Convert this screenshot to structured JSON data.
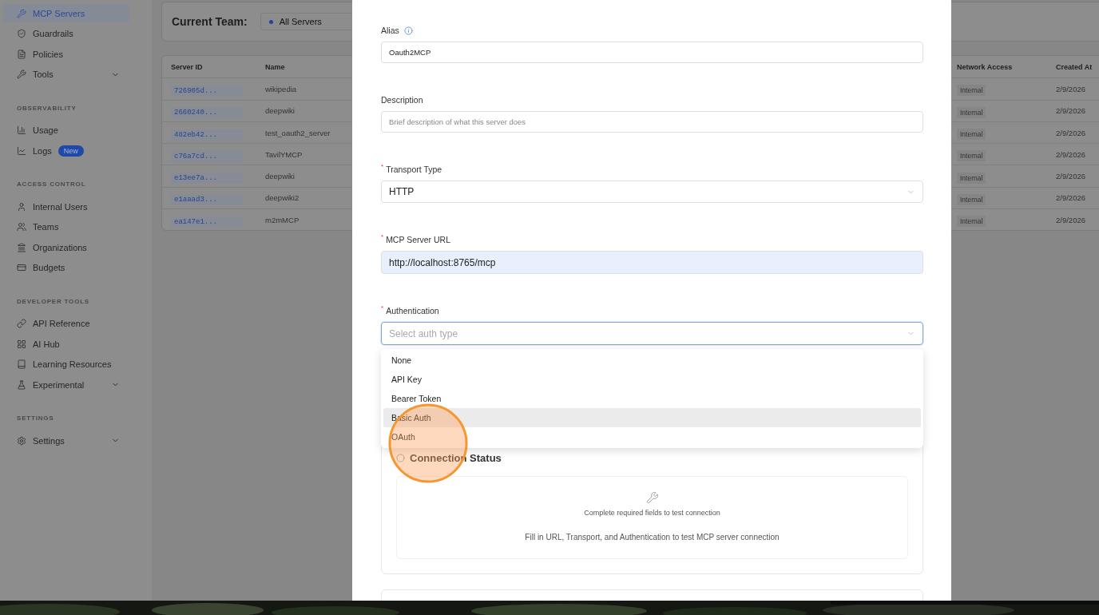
{
  "sidebar": {
    "groups": [
      {
        "items": [
          {
            "label": "MCP Servers",
            "selected": true
          },
          {
            "label": "Guardrails",
            "selected": false
          },
          {
            "label": "Policies",
            "selected": false
          },
          {
            "label": "Tools",
            "selected": false,
            "expanded": false
          }
        ]
      },
      {
        "heading": "OBSERVABILITY",
        "items": [
          {
            "label": "Usage",
            "selected": false
          },
          {
            "label": "Logs",
            "selected": false,
            "badge": "New"
          }
        ]
      },
      {
        "heading": "ACCESS CONTROL",
        "items": [
          {
            "label": "Internal Users",
            "selected": false
          },
          {
            "label": "Teams",
            "selected": false
          },
          {
            "label": "Organizations",
            "selected": false
          },
          {
            "label": "Budgets",
            "selected": false
          }
        ]
      },
      {
        "heading": "DEVELOPER TOOLS",
        "items": [
          {
            "label": "API Reference",
            "selected": false
          },
          {
            "label": "AI Hub",
            "selected": false
          },
          {
            "label": "Learning Resources",
            "selected": false
          },
          {
            "label": "Experimental",
            "selected": false,
            "expanded": false
          }
        ]
      },
      {
        "heading": "SETTINGS",
        "items": [
          {
            "label": "Settings",
            "selected": false,
            "expanded": false
          }
        ]
      }
    ]
  },
  "team": {
    "label": "Current Team:",
    "value": "All Servers"
  },
  "table": {
    "columns": [
      "Server ID",
      "Name",
      "Network Access",
      "Created At"
    ],
    "rows": [
      {
        "server_id": "726905d...",
        "name": "wikipedia",
        "network_access": "Internal",
        "created_at": "2/9/2026"
      },
      {
        "server_id": "2660240...",
        "name": "deepwiki",
        "network_access": "Internal",
        "created_at": "2/9/2026"
      },
      {
        "server_id": "482eb42...",
        "name": "test_oauth2_server",
        "network_access": "Internal",
        "created_at": "2/9/2026"
      },
      {
        "server_id": "c76a7cd...",
        "name": "TavilYMCP",
        "network_access": "Internal",
        "created_at": "2/9/2026"
      },
      {
        "server_id": "e13ee7a...",
        "name": "deepwiki",
        "network_access": "Internal",
        "created_at": "2/9/2026"
      },
      {
        "server_id": "e1aaad3...",
        "name": "deepwiki2",
        "network_access": "Internal",
        "created_at": "2/9/2026"
      },
      {
        "server_id": "ea147e1...",
        "name": "m2mMCP",
        "network_access": "Internal",
        "created_at": "2/9/2026"
      }
    ]
  },
  "modal": {
    "fields": [
      {
        "kind": "text",
        "label": "Alias",
        "info": true,
        "value": "Oauth2MCP"
      },
      {
        "kind": "text",
        "label": "Description",
        "placeholder": "Brief description of what this server does"
      },
      {
        "kind": "select",
        "label": "Transport Type",
        "required_mark": "*",
        "value": "HTTP",
        "focused": false
      },
      {
        "kind": "url",
        "label": "MCP Server URL",
        "required_mark": "*",
        "value": "http://localhost:8765/mcp"
      },
      {
        "kind": "select",
        "label": "Authentication",
        "required_mark": "*",
        "placeholder": "Select auth type",
        "focused": true,
        "open": true,
        "options": [
          {
            "label": "None",
            "hovered": false
          },
          {
            "label": "API Key",
            "hovered": false
          },
          {
            "label": "Bearer Token",
            "hovered": false
          },
          {
            "label": "Basic Auth",
            "hovered": true
          },
          {
            "label": "OAuth",
            "hovered": false
          }
        ]
      }
    ],
    "connection": {
      "title": "Connection Status",
      "message": "Complete required fields to test connection",
      "hint": "Fill in URL, Transport, and Authentication to test MCP server connection"
    }
  }
}
